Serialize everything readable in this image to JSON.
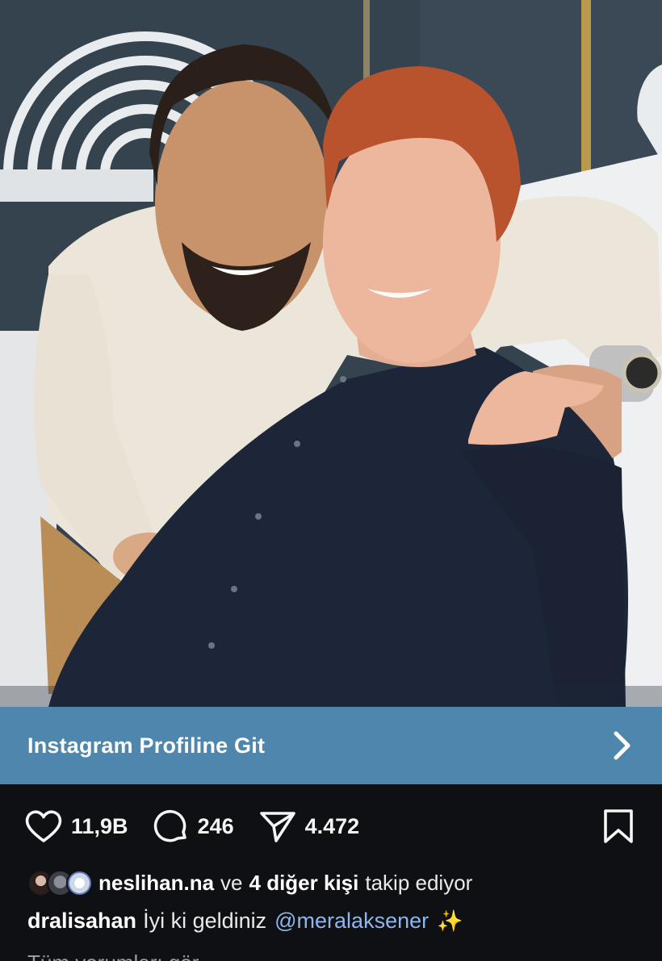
{
  "photo": {
    "subject-description-hidden": ""
  },
  "banner": {
    "label": "Instagram Profiline Git"
  },
  "actions": {
    "likes": "11,9B",
    "comments": "246",
    "shares": "4.472"
  },
  "followers": {
    "username": "neslihan.na",
    "connector": "ve",
    "others": "4 diğer kişi",
    "suffix": "takip ediyor"
  },
  "caption": {
    "username": "dralisahan",
    "text": "İyi ki geldiniz",
    "mention": "@meralaksener",
    "emoji": "✨"
  },
  "comments_link": "Tüm yorumları gör",
  "colors": {
    "banner": "#4f86ad",
    "background": "#0f1014",
    "mention": "#8fb6ea"
  },
  "icons": [
    "heart-icon",
    "comment-icon",
    "send-icon",
    "bookmark-icon",
    "chevron-right-icon"
  ]
}
